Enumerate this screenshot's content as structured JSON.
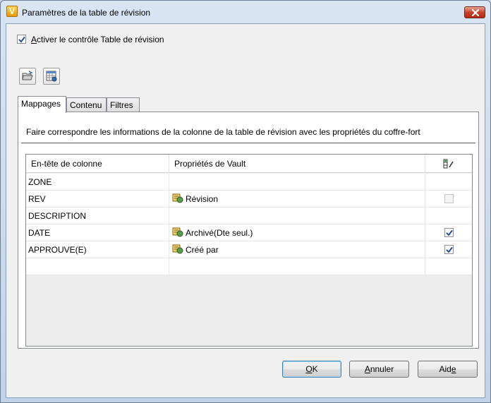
{
  "window": {
    "title": "Paramètres de la table de révision",
    "app_icon_letter": "V"
  },
  "activer": {
    "checked": true,
    "label_rest": "ctiver le contrôle Table de révision",
    "label_accel": "A"
  },
  "toolbar": {
    "open_icon": "open-folder-icon",
    "settings_icon": "table-settings-icon"
  },
  "tabs": [
    {
      "label": "Mappages",
      "active": true
    },
    {
      "label": "Contenu",
      "active": false
    },
    {
      "label": "Filtres",
      "active": false
    }
  ],
  "panel": {
    "description": "Faire correspondre les informations de la colonne de la table de révision avec les propriétés du coffre-fort"
  },
  "grid": {
    "headers": {
      "column": "En-tête de colonne",
      "vault": "Propriétés de Vault",
      "edit_icon": "column-edit-icon"
    },
    "rows": [
      {
        "column": "ZONE",
        "property": "",
        "checkbox": "none"
      },
      {
        "column": "REV",
        "property": "Révision",
        "checkbox": "disabled"
      },
      {
        "column": "DESCRIPTION",
        "property": "",
        "checkbox": "none"
      },
      {
        "column": "DATE",
        "property": "Archivé(Dte seul.)",
        "checkbox": "checked"
      },
      {
        "column": "APPROUVE(E)",
        "property": "Créé par",
        "checkbox": "checked"
      },
      {
        "column": "",
        "property": "",
        "checkbox": "none"
      }
    ]
  },
  "buttons": {
    "ok_accel": "O",
    "ok_rest": "K",
    "cancel_accel": "A",
    "cancel_rest": "nnuler",
    "help_rest": "Aid",
    "help_accel": "e"
  }
}
